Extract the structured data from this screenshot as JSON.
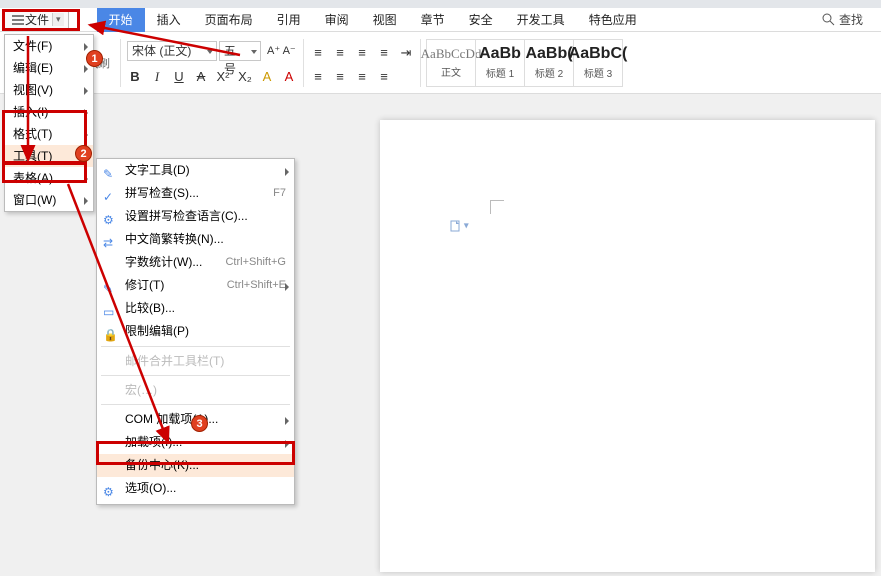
{
  "filebtn": {
    "label": "文件"
  },
  "tabs": {
    "start": "开始",
    "insert": "插入",
    "layout": "页面布局",
    "ref": "引用",
    "review": "审阅",
    "view": "视图",
    "section": "章节",
    "security": "安全",
    "dev": "开发工具",
    "special": "特色应用"
  },
  "find": "查找",
  "font": {
    "name": "宋体 (正文)",
    "size": "五号",
    "fmtbrush": "式刷"
  },
  "styles": [
    {
      "prev": "AaBbCcDd",
      "lab": "正文",
      "big": false
    },
    {
      "prev": "AaBb",
      "lab": "标题 1",
      "big": true
    },
    {
      "prev": "AaBb(",
      "lab": "标题 2",
      "big": true
    },
    {
      "prev": "AaBbC(",
      "lab": "标题 3",
      "big": true
    }
  ],
  "dd1": [
    {
      "label": "文件(F)"
    },
    {
      "label": "编辑(E)"
    },
    {
      "label": "视图(V)"
    },
    {
      "label": "插入(I)"
    },
    {
      "label": "格式(T)"
    },
    {
      "label": "工具(T)",
      "hov": true
    },
    {
      "label": "表格(A)"
    },
    {
      "label": "窗口(W)"
    }
  ],
  "dd2": {
    "items1": [
      {
        "ic": "✎",
        "label": "文字工具(D)"
      },
      {
        "ic": "✓",
        "label": "拼写检查(S)...",
        "sc": "F7"
      },
      {
        "ic": "⚙",
        "label": "设置拼写检查语言(C)..."
      },
      {
        "ic": "⇄",
        "label": "中文简繁转换(N)..."
      },
      {
        "ic": "",
        "label": "字数统计(W)...",
        "sc": "Ctrl+Shift+G"
      },
      {
        "ic": "✎",
        "label": "修订(T)",
        "sc": "Ctrl+Shift+E"
      },
      {
        "ic": "▭",
        "label": "比较(B)..."
      },
      {
        "ic": "🔒",
        "label": "限制编辑(P)"
      }
    ],
    "mut1": "邮件合并工具栏(T)",
    "mut2": "宏(…)",
    "items2": [
      {
        "label": "COM 加载项(A)..."
      },
      {
        "label": "加载项(I)..."
      },
      {
        "label": "备份中心(K)...",
        "hov": true
      },
      {
        "ic": "⚙",
        "label": "选项(O)..."
      }
    ]
  },
  "co": {
    "c1": "1",
    "c2": "2",
    "c3": "3"
  }
}
